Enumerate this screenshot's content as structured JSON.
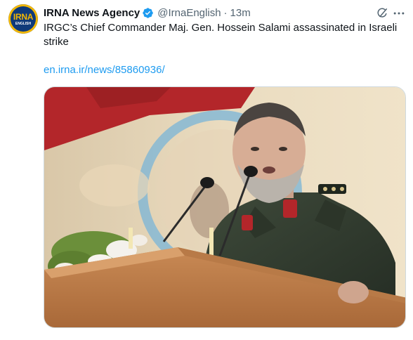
{
  "account": {
    "name": "IRNA News Agency",
    "handle": "@IrnaEnglish",
    "separator": "·",
    "time": "13m",
    "avatar_logo": "IRNA",
    "avatar_logo_sub": "ENGLISH",
    "verified_icon": "verified-badge-icon"
  },
  "tweet": {
    "text": "IRGC’s Chief Commander Maj. Gen. Hossein Salami assassinated in Israeli strike",
    "link": "en.irna.ir/news/85860936/"
  },
  "media": {
    "subject": "photo-man-at-podium"
  },
  "icons": {
    "grok": "grok-icon",
    "more": "more-icon"
  },
  "colors": {
    "accent": "#1d9bf0",
    "text": "#0f1419",
    "secondary": "#536471",
    "border": "#cfd9de"
  }
}
